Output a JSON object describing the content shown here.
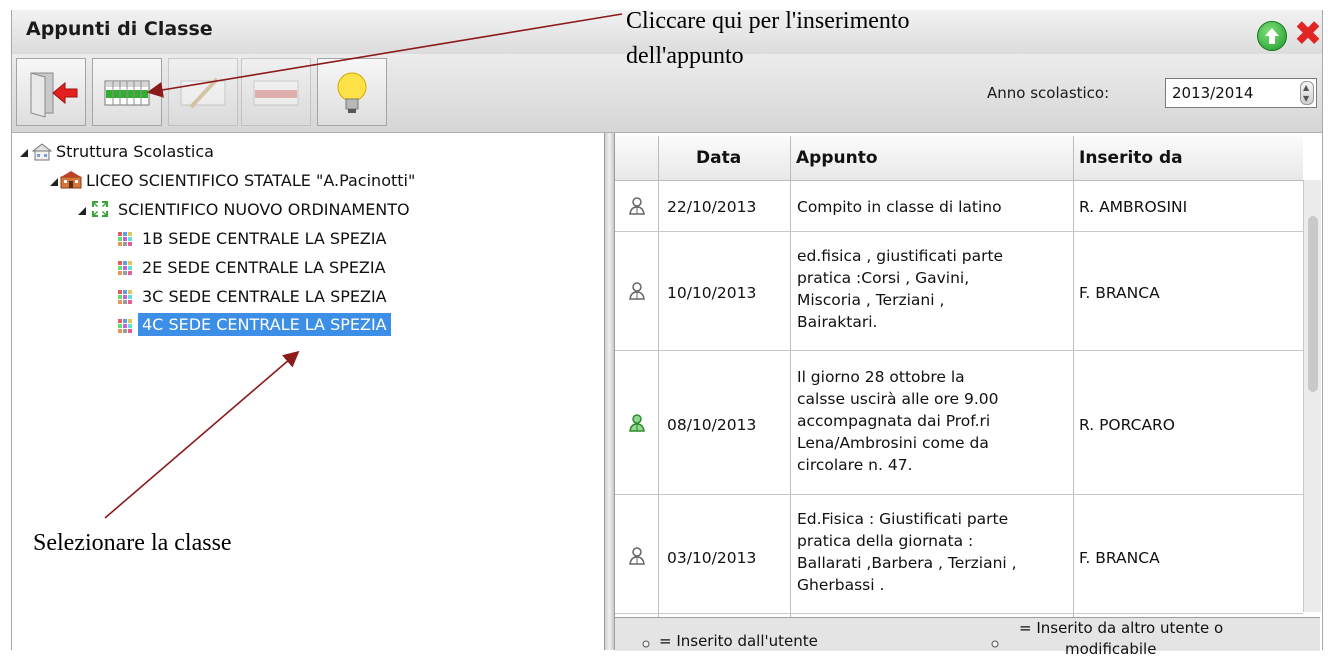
{
  "window": {
    "title": "Appunti di Classe"
  },
  "toolbar": {
    "buttons": [
      {
        "name": "exit",
        "enabled": true
      },
      {
        "name": "new-note",
        "enabled": true
      },
      {
        "name": "edit-note",
        "enabled": false
      },
      {
        "name": "delete-note",
        "enabled": false
      },
      {
        "name": "help",
        "enabled": true
      }
    ],
    "year_label": "Anno scolastico:",
    "year_value": "2013/2014"
  },
  "tree": {
    "root": "Struttura Scolastica",
    "school": "LICEO SCIENTIFICO STATALE \"A.Pacinotti\"",
    "course": "SCIENTIFICO NUOVO ORDINAMENTO",
    "classes": [
      {
        "label": "1B SEDE CENTRALE LA SPEZIA",
        "selected": false
      },
      {
        "label": "2E SEDE CENTRALE LA SPEZIA",
        "selected": false
      },
      {
        "label": "3C SEDE CENTRALE LA SPEZIA",
        "selected": false
      },
      {
        "label": "4C SEDE CENTRALE LA SPEZIA",
        "selected": true
      }
    ]
  },
  "table": {
    "headers": [
      "Data",
      "Appunto",
      "Inserito da"
    ],
    "rows": [
      {
        "icon": "other-user",
        "date": "22/10/2013",
        "note": [
          "Compito in classe di latino"
        ],
        "author": "R. AMBROSINI"
      },
      {
        "icon": "other-user",
        "date": "10/10/2013",
        "note": [
          "ed.fisica , giustificati parte",
          "pratica :Corsi , Gavini,",
          "Miscoria , Terziani ,",
          "Bairaktari."
        ],
        "author": "F. BRANCA"
      },
      {
        "icon": "own-user",
        "date": "08/10/2013",
        "note": [
          "Il giorno 28 ottobre la",
          "calsse uscirà alle ore 9.00",
          "accompagnata dai Prof.ri",
          "Lena/Ambrosini come da",
          "circolare n. 47."
        ],
        "author": "R. PORCARO"
      },
      {
        "icon": "other-user",
        "date": "03/10/2013",
        "note": [
          "Ed.Fisica : Giustificati parte",
          "pratica della giornata :",
          "Ballarati ,Barbera , Terziani ,",
          "Gherbassi ."
        ],
        "author": "F. BRANCA"
      }
    ]
  },
  "legend": {
    "own": "= Inserito dall'utente",
    "other_line1": "= Inserito da altro utente o",
    "other_line2": "modificabile"
  },
  "annotations": {
    "top_line1": "Cliccare qui per l'inserimento",
    "top_line2": "dell'appunto",
    "left": "Selezionare la classe"
  },
  "colors": {
    "selection": "#3d8ee6",
    "arrow": "#8b1a1a",
    "own_user": "#3aa33a",
    "other_user": "#666666"
  }
}
